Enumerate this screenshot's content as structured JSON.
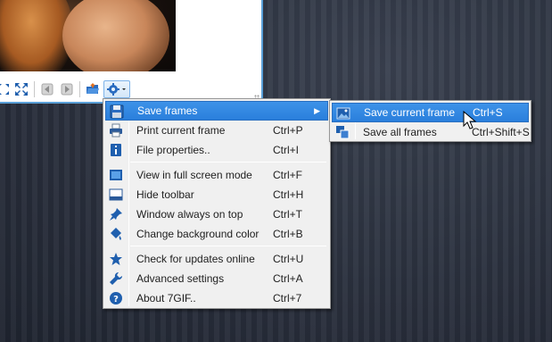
{
  "menu": {
    "items": [
      {
        "label": "Save frames",
        "shortcut": "",
        "icon": "floppy-icon",
        "has_submenu": true
      },
      {
        "label": "Print current frame",
        "shortcut": "Ctrl+P",
        "icon": "printer-icon"
      },
      {
        "label": "File properties..",
        "shortcut": "Ctrl+I",
        "icon": "info-icon"
      },
      {
        "label": "View in full screen mode",
        "shortcut": "Ctrl+F",
        "icon": "fullscreen-icon"
      },
      {
        "label": "Hide toolbar",
        "shortcut": "Ctrl+H",
        "icon": "toolbar-icon"
      },
      {
        "label": "Window always on top",
        "shortcut": "Ctrl+T",
        "icon": "pin-icon"
      },
      {
        "label": "Change background color",
        "shortcut": "Ctrl+B",
        "icon": "paint-bucket-icon"
      },
      {
        "label": "Check for updates online",
        "shortcut": "Ctrl+U",
        "icon": "star-icon"
      },
      {
        "label": "Advanced settings",
        "shortcut": "Ctrl+A",
        "icon": "wrench-icon"
      },
      {
        "label": "About 7GIF..",
        "shortcut": "Ctrl+7",
        "icon": "help-icon"
      }
    ]
  },
  "submenu": {
    "items": [
      {
        "label": "Save current frame",
        "shortcut": "Ctrl+S",
        "icon": "picture-icon"
      },
      {
        "label": "Save all frames",
        "shortcut": "Ctrl+Shift+S",
        "icon": "frames-icon"
      }
    ]
  },
  "colors": {
    "highlight": "#3d92e8",
    "menu_bg": "#f0f0f0",
    "window_border": "#5aa0d8",
    "desktop": "#2e3442"
  }
}
